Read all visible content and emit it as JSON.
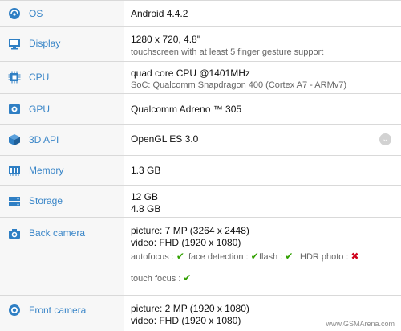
{
  "rows": [
    {
      "id": "os",
      "label": "OS",
      "icon": "os-icon",
      "v1": "Android 4.4.2"
    },
    {
      "id": "display",
      "label": "Display",
      "icon": "display-icon",
      "v1": "1280 x 720, 4.8\"",
      "v2": "touchscreen with at least 5 finger gesture support"
    },
    {
      "id": "cpu",
      "label": "CPU",
      "icon": "cpu-icon",
      "v1": "quad core CPU @1401MHz",
      "v2": "SoC: Qualcomm Snapdragon 400 (Cortex A7 - ARMv7)"
    },
    {
      "id": "gpu",
      "label": "GPU",
      "icon": "gpu-icon",
      "v1": "Qualcomm Adreno ™ 305"
    },
    {
      "id": "api",
      "label": "3D API",
      "icon": "3d-api-icon",
      "v1": "OpenGL ES 3.0",
      "expand_icon": "chevron-down-icon"
    },
    {
      "id": "memory",
      "label": "Memory",
      "icon": "memory-icon",
      "v1": "1.3 GB"
    },
    {
      "id": "storage",
      "label": "Storage",
      "icon": "storage-icon",
      "v1": "12 GB",
      "v2": "4.8 GB"
    },
    {
      "id": "back",
      "label": "Back camera",
      "icon": "camera-icon",
      "v1": "picture: 7 MP (3264 x 2448)",
      "v2": "video: FHD (1920 x 1080)",
      "features": [
        {
          "label": "autofocus :",
          "status": "yes"
        },
        {
          "label": "face detection :",
          "status": "yes"
        },
        {
          "label": "flash :",
          "status": "yes"
        },
        {
          "label": "HDR photo :",
          "status": "no"
        },
        {
          "label": "touch focus :",
          "status": "yes"
        }
      ]
    },
    {
      "id": "front",
      "label": "Front camera",
      "icon": "front-camera-icon",
      "v1": "picture: 2 MP (1920 x 1080)",
      "v2": "video: FHD (1920 x 1080)"
    }
  ],
  "symbols": {
    "check": "✔",
    "cross": "✖",
    "chevron": "⌄"
  },
  "colors": {
    "label": "#3a86c8",
    "icon": "#2f7fc4",
    "check": "#31a000",
    "cross": "#d0021b"
  },
  "watermark": "www.GSMArena.com"
}
